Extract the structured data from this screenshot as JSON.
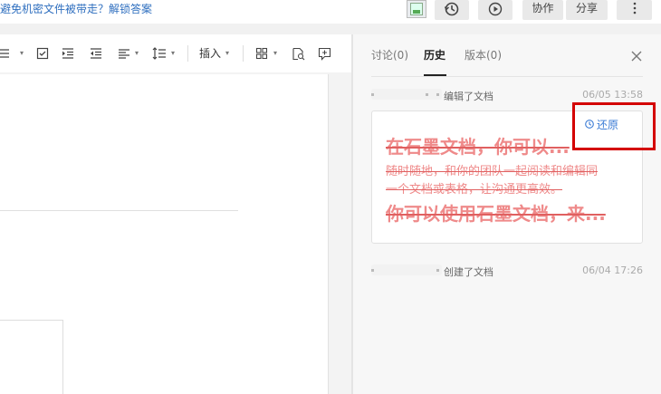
{
  "top": {
    "link_text": "如何避免机密文件被带走？解锁答案",
    "collab_label": "协作",
    "share_label": "分享"
  },
  "toolbar": {
    "insert_label": "插入"
  },
  "panel": {
    "tabs": [
      {
        "label": "讨论(0)"
      },
      {
        "label": "历史"
      },
      {
        "label": "版本(0)"
      }
    ],
    "entries": [
      {
        "action": "编辑了文档",
        "time": "06/05 13:58"
      },
      {
        "action": "创建了文档",
        "time": "06/04 17:26"
      }
    ],
    "card": {
      "restore_label": "还原",
      "title": "在石墨文档，你可以...",
      "line1": "随时随地，和你的团队一起阅读和编辑同",
      "line2": "一个文档或表格，让沟通更高效。",
      "line3": "你可以使用石墨文档，来..."
    }
  }
}
